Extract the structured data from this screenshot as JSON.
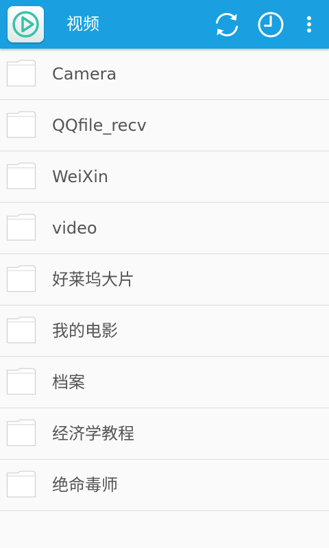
{
  "app_bar": {
    "title": "视频",
    "app_icon": "play-logo-icon",
    "actions": [
      {
        "name": "sync",
        "icon": "sync-icon"
      },
      {
        "name": "history",
        "icon": "clock-icon"
      },
      {
        "name": "more",
        "icon": "overflow-menu-icon"
      }
    ]
  },
  "folders": [
    {
      "name": "Camera"
    },
    {
      "name": "QQfile_recv"
    },
    {
      "name": "WeiXin"
    },
    {
      "name": "video"
    },
    {
      "name": "好莱坞大片"
    },
    {
      "name": "我的电影"
    },
    {
      "name": "档案"
    },
    {
      "name": "经济学教程"
    },
    {
      "name": "绝命毒师"
    }
  ],
  "colors": {
    "app_bar": "#1aa0e0",
    "background": "#fafafa",
    "divider": "#dcdcdc",
    "text": "#555555",
    "icon_accent": "#3dbfa8"
  }
}
